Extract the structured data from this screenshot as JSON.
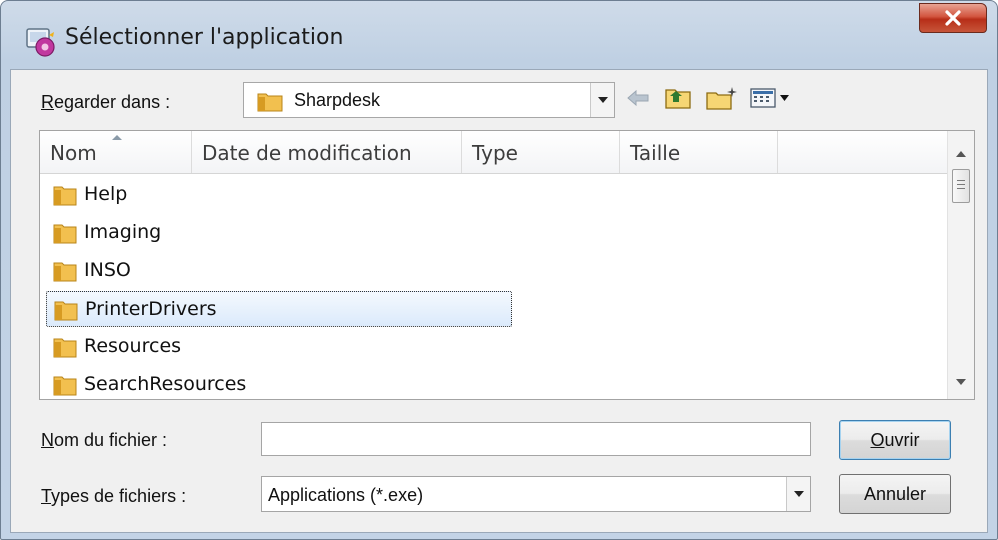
{
  "window": {
    "title": "Sélectionner l'application",
    "close_label": "X"
  },
  "toolbar": {
    "look_in_label_underlined": "R",
    "look_in_label_rest": "egarder dans :",
    "look_in_value": "Sharpdesk",
    "icons": [
      "back-arrow-icon",
      "up-folder-icon",
      "new-folder-icon",
      "view-menu-icon"
    ]
  },
  "listview": {
    "columns": [
      "Nom",
      "Date de modification",
      "Type",
      "Taille"
    ],
    "rows": [
      {
        "name": "Help",
        "selected": false
      },
      {
        "name": "Imaging",
        "selected": false
      },
      {
        "name": "INSO",
        "selected": false
      },
      {
        "name": "PrinterDrivers",
        "selected": true
      },
      {
        "name": "Resources",
        "selected": false
      },
      {
        "name": "SearchResources",
        "selected": false
      }
    ]
  },
  "form": {
    "filename_label_underlined": "N",
    "filename_label_rest": "om du fichier :",
    "filename_value": "",
    "filetype_label_underlined": "T",
    "filetype_label_rest": "ypes de fichiers :",
    "filetype_value": "Applications (*.exe)"
  },
  "buttons": {
    "open_underlined": "O",
    "open_rest": "uvrir",
    "cancel": "Annuler"
  },
  "colors": {
    "folder": "#e8b84a",
    "selection": "#dbeafb",
    "close_button": "#c7402a"
  }
}
